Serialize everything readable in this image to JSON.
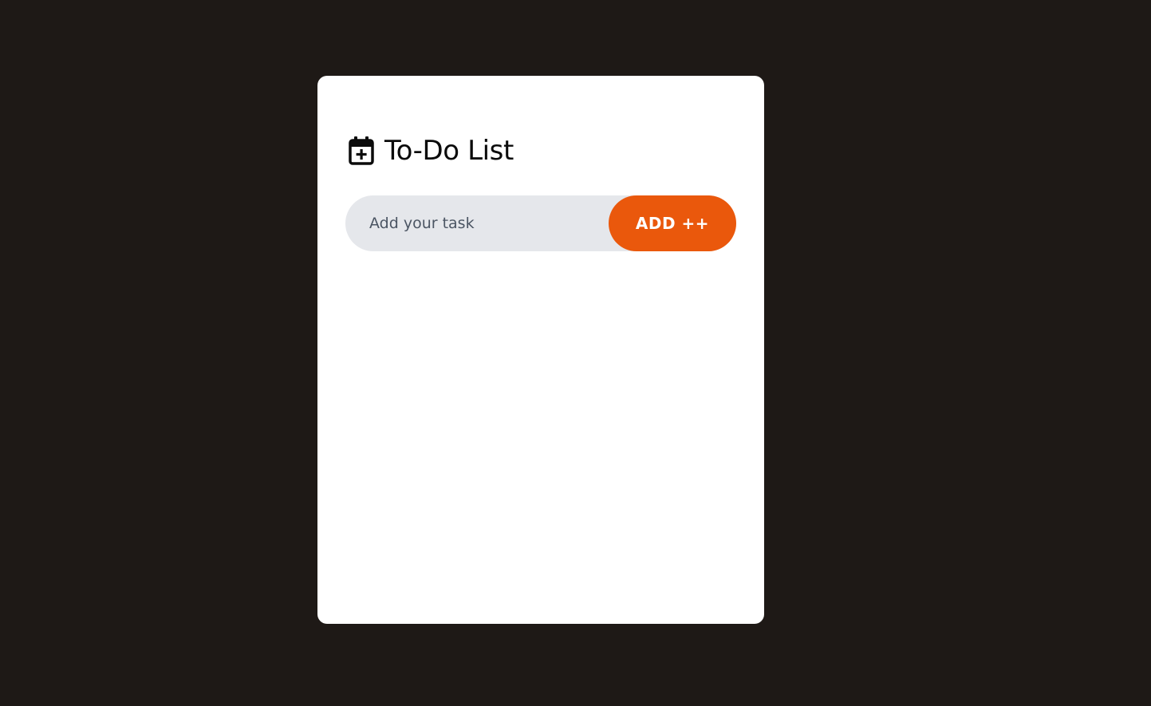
{
  "app": {
    "title": "To-Do List",
    "title_icon": "calendar-plus-icon"
  },
  "form": {
    "input_value": "",
    "input_placeholder": "Add your task",
    "add_button_label": "ADD ++"
  },
  "tasks": [],
  "colors": {
    "background": "#1e1916",
    "card": "#ffffff",
    "input_background": "#e5e7eb",
    "accent": "#ea580c",
    "button_text": "#ffffff",
    "title_text": "#0b0b0b"
  }
}
